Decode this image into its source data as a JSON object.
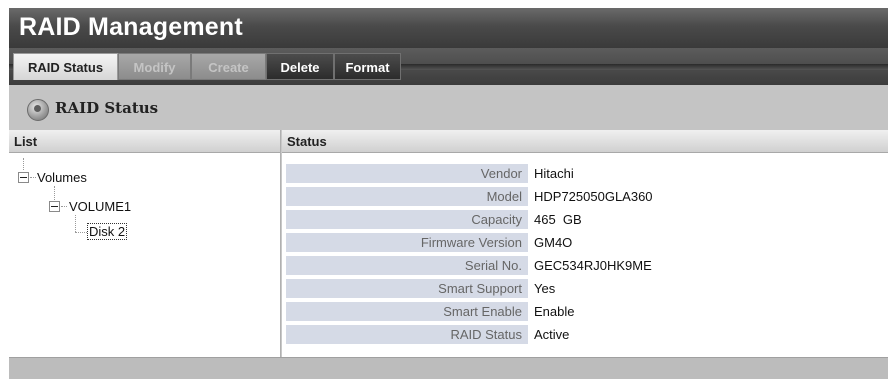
{
  "app": {
    "title": "RAID Management"
  },
  "tabs": [
    {
      "label": "RAID Status",
      "state": "active"
    },
    {
      "label": "Modify",
      "state": "disabled"
    },
    {
      "label": "Create",
      "state": "disabled"
    },
    {
      "label": "Delete",
      "state": "normal"
    },
    {
      "label": "Format",
      "state": "normal"
    }
  ],
  "section": {
    "title": "RAID Status",
    "icon": "disk-icon"
  },
  "list_panel": {
    "header": "List",
    "tree": {
      "root": "Volumes",
      "volume": "VOLUME1",
      "disk": "Disk 2"
    }
  },
  "status_panel": {
    "header": "Status",
    "rows": [
      {
        "label": "Vendor",
        "value": "Hitachi"
      },
      {
        "label": "Model",
        "value": "HDP725050GLA360"
      },
      {
        "label": "Capacity",
        "value": "465  GB"
      },
      {
        "label": "Firmware Version",
        "value": "GM4O"
      },
      {
        "label": "Serial No.",
        "value": "GEC534RJ0HK9ME"
      },
      {
        "label": "Smart Support",
        "value": "Yes"
      },
      {
        "label": "Smart Enable",
        "value": "Enable"
      },
      {
        "label": "RAID Status",
        "value": "Active"
      }
    ]
  }
}
